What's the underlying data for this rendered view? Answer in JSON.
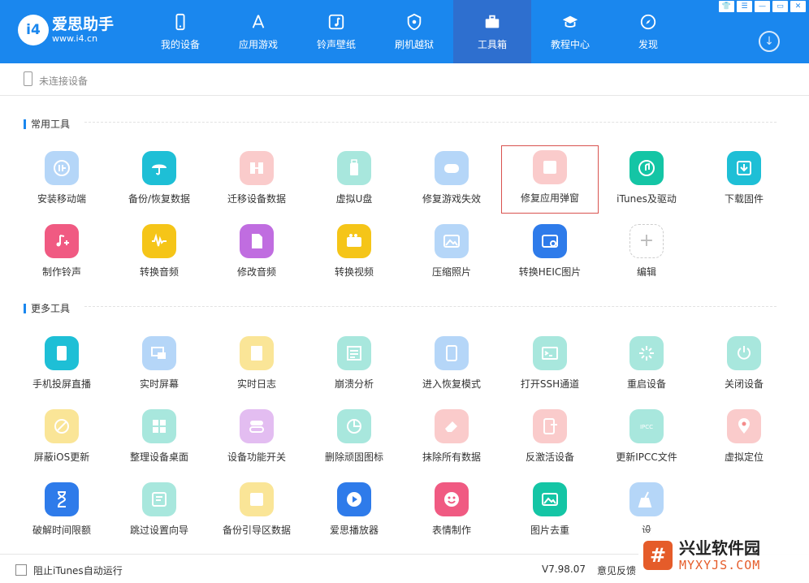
{
  "window": {
    "logo_mark": "i4",
    "logo_name": "爱思助手",
    "logo_url": "www.i4.cn",
    "controls": [
      "👕",
      "☰",
      "—",
      "▭",
      "✕"
    ]
  },
  "nav": [
    {
      "label": "我的设备",
      "icon": "phone-icon"
    },
    {
      "label": "应用游戏",
      "icon": "app-store-icon"
    },
    {
      "label": "铃声壁纸",
      "icon": "music-icon"
    },
    {
      "label": "刷机越狱",
      "icon": "shield-icon"
    },
    {
      "label": "工具箱",
      "icon": "toolbox-icon",
      "active": true
    },
    {
      "label": "教程中心",
      "icon": "graduation-cap-icon"
    },
    {
      "label": "发现",
      "icon": "compass-icon"
    }
  ],
  "status": {
    "text": "未连接设备"
  },
  "sections": [
    {
      "title": "常用工具",
      "tools": [
        {
          "label": "安装移动端",
          "icon": "i4-app-icon",
          "color": "#5aa3f0",
          "faded": true
        },
        {
          "label": "备份/恢复数据",
          "icon": "umbrella-icon",
          "color": "#1ebfd6"
        },
        {
          "label": "迁移设备数据",
          "icon": "transfer-icon",
          "color": "#f48b8b",
          "faded": true
        },
        {
          "label": "虚拟U盘",
          "icon": "usb-drive-icon",
          "color": "#3dc9b3",
          "faded": true
        },
        {
          "label": "修复游戏失效",
          "icon": "gamepad-icon",
          "color": "#5aa3f0",
          "faded": true
        },
        {
          "label": "修复应用弹窗",
          "icon": "app-repair-icon",
          "color": "#f48b8b",
          "faded": true,
          "selected": true
        },
        {
          "label": "iTunes及驱动",
          "icon": "itunes-icon",
          "color": "#14c5a5"
        },
        {
          "label": "下载固件",
          "icon": "firmware-download-icon",
          "color": "#1ebfd6"
        },
        {
          "label": "制作铃声",
          "icon": "ringtone-icon",
          "color": "#f05a82"
        },
        {
          "label": "转换音频",
          "icon": "audio-wave-icon",
          "color": "#f5c518"
        },
        {
          "label": "修改音频",
          "icon": "audio-file-icon",
          "color": "#c06de0"
        },
        {
          "label": "转换视频",
          "icon": "video-icon",
          "color": "#f5c518"
        },
        {
          "label": "压缩照片",
          "icon": "photo-icon",
          "color": "#5aa3f0",
          "faded": true
        },
        {
          "label": "转换HEIC图片",
          "icon": "heic-icon",
          "color": "#2e7bea"
        },
        {
          "label": "编辑",
          "icon": "plus-icon",
          "color": "#ffffff",
          "edit": true
        }
      ]
    },
    {
      "title": "更多工具",
      "tools": [
        {
          "label": "手机投屏直播",
          "icon": "screen-cast-icon",
          "color": "#1ebfd6"
        },
        {
          "label": "实时屏幕",
          "icon": "live-screen-icon",
          "color": "#5aa3f0",
          "faded": true
        },
        {
          "label": "实时日志",
          "icon": "log-icon",
          "color": "#f5c518",
          "faded": true
        },
        {
          "label": "崩溃分析",
          "icon": "crash-analysis-icon",
          "color": "#3dc9b3",
          "faded": true
        },
        {
          "label": "进入恢复模式",
          "icon": "recovery-mode-icon",
          "color": "#5aa3f0",
          "faded": true
        },
        {
          "label": "打开SSH通道",
          "icon": "terminal-icon",
          "color": "#3dc9b3",
          "faded": true
        },
        {
          "label": "重启设备",
          "icon": "restart-icon",
          "color": "#3dc9b3",
          "faded": true
        },
        {
          "label": "关闭设备",
          "icon": "power-icon",
          "color": "#3dc9b3",
          "faded": true
        },
        {
          "label": "屏蔽iOS更新",
          "icon": "block-update-icon",
          "color": "#f5c518",
          "faded": true
        },
        {
          "label": "整理设备桌面",
          "icon": "grid-icon",
          "color": "#3dc9b3",
          "faded": true
        },
        {
          "label": "设备功能开关",
          "icon": "toggle-icon",
          "color": "#c06de0",
          "faded": true
        },
        {
          "label": "删除顽固图标",
          "icon": "pie-chart-icon",
          "color": "#3dc9b3",
          "faded": true
        },
        {
          "label": "抹除所有数据",
          "icon": "eraser-icon",
          "color": "#f48b8b",
          "faded": true
        },
        {
          "label": "反激活设备",
          "icon": "deactivate-icon",
          "color": "#f48b8b",
          "faded": true
        },
        {
          "label": "更新IPCC文件",
          "icon": "ipcc-icon",
          "color": "#3dc9b3",
          "faded": true
        },
        {
          "label": "虚拟定位",
          "icon": "location-pin-icon",
          "color": "#f48b8b",
          "faded": true
        },
        {
          "label": "破解时间限额",
          "icon": "hourglass-icon",
          "color": "#2e7bea"
        },
        {
          "label": "跳过设置向导",
          "icon": "setup-wizard-icon",
          "color": "#3dc9b3",
          "faded": true
        },
        {
          "label": "备份引导区数据",
          "icon": "boot-backup-icon",
          "color": "#f5c518",
          "faded": true
        },
        {
          "label": "爱思播放器",
          "icon": "play-icon",
          "color": "#2e7bea"
        },
        {
          "label": "表情制作",
          "icon": "emoji-icon",
          "color": "#f05a82"
        },
        {
          "label": "图片去重",
          "icon": "photo-dedupe-icon",
          "color": "#14c5a5"
        },
        {
          "label": "设",
          "icon": "broom-icon",
          "color": "#5aa3f0",
          "faded": true
        }
      ]
    }
  ],
  "footer": {
    "checkbox_label": "阻止iTunes自动运行",
    "version": "V7.98.07",
    "feedback": "意见反馈"
  },
  "watermark": {
    "mark": "#",
    "name": "兴业软件园",
    "url": "MYXYJS.COM"
  }
}
